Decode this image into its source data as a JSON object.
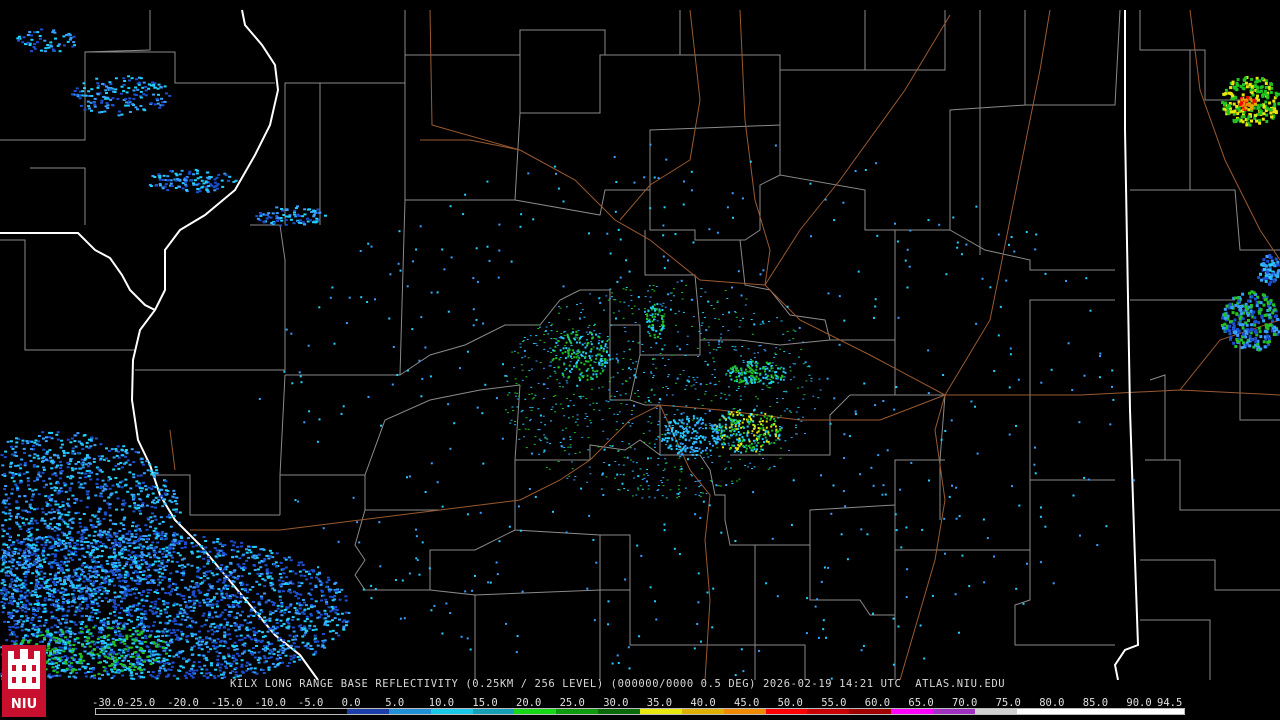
{
  "product": {
    "title": "KILX LONG RANGE BASE REFLECTIVITY (0.25KM / 256 LEVEL) (000000/0000 0.5 DEG) 2026-02-19 14:21 UTC  ATLAS.NIU.EDU"
  },
  "logo": {
    "text": "NIU",
    "color": "#c8102e"
  },
  "scale": {
    "labels": [
      "-30.0",
      "-25.0",
      "-20.0",
      "-15.0",
      "-10.0",
      "-5.0",
      "0.0",
      "5.0",
      "10.0",
      "15.0",
      "20.0",
      "25.0",
      "30.0",
      "35.0",
      "40.0",
      "45.0",
      "50.0",
      "55.0",
      "60.0",
      "65.0",
      "70.0",
      "75.0",
      "80.0",
      "85.0",
      "90.0",
      "94.5"
    ],
    "colors": [
      "#000000",
      "#000000",
      "#000000",
      "#000000",
      "#000000",
      "#000000",
      "#1a3fa8",
      "#1f8fd8",
      "#19c8e8",
      "#16a0b8",
      "#17d817",
      "#0e9c0e",
      "#0a6a0a",
      "#e8e80c",
      "#e0b000",
      "#f08a00",
      "#ff0000",
      "#c80000",
      "#a00000",
      "#ff00ff",
      "#a030c0",
      "#d0d0d0",
      "#ffffff",
      "#ffffff",
      "#ffffff",
      "#ffffff"
    ]
  },
  "map_colors": {
    "state_border": "#ffffff",
    "county_border": "#8a8a8a",
    "highway": "#9a5a30",
    "echo_light": "#39a0ff",
    "echo_cyan": "#22d0ff",
    "echo_green": "#22c022",
    "echo_blue": "#1c4fd0"
  }
}
